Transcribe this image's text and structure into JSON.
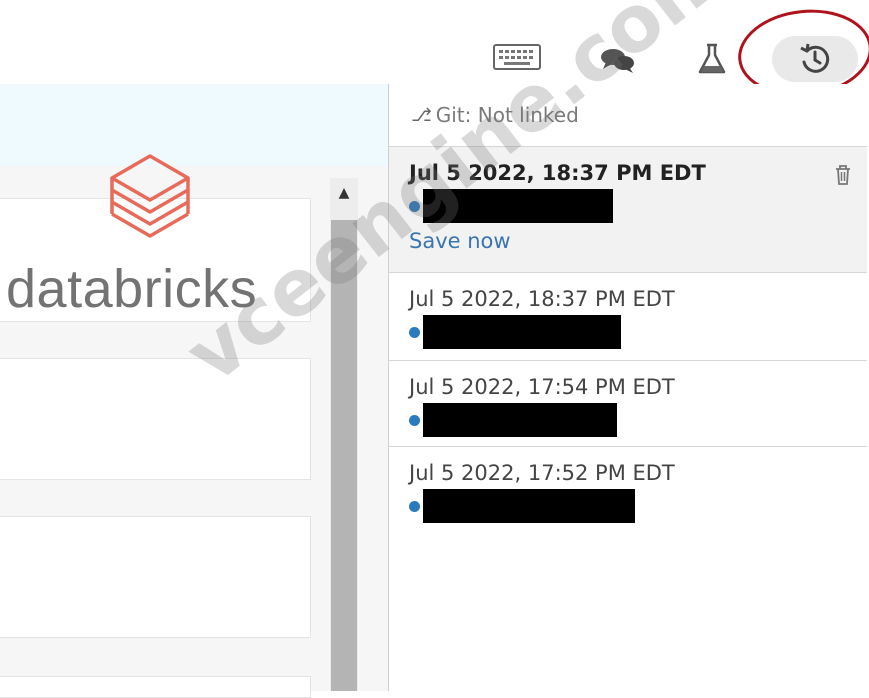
{
  "brand": {
    "name": "databricks",
    "accent": "#e86a5a"
  },
  "toolbar": {
    "icons": [
      "keyboard-icon",
      "comments-icon",
      "experiment-flask-icon",
      "revision-history-icon"
    ]
  },
  "history": {
    "git_status": "Git: Not linked",
    "save_now_label": "Save now",
    "versions": [
      {
        "time": "Jul 5 2022, 18:37 PM EDT"
      },
      {
        "time": "Jul 5 2022, 18:37 PM EDT"
      },
      {
        "time": "Jul 5 2022, 17:54 PM EDT"
      },
      {
        "time": "Jul 5 2022, 17:52 PM EDT"
      }
    ]
  },
  "watermark": "vceengine.com",
  "colors": {
    "author_dot": "#2a7bbd",
    "link": "#3a75b0",
    "highlight_circle": "#b0121b"
  }
}
